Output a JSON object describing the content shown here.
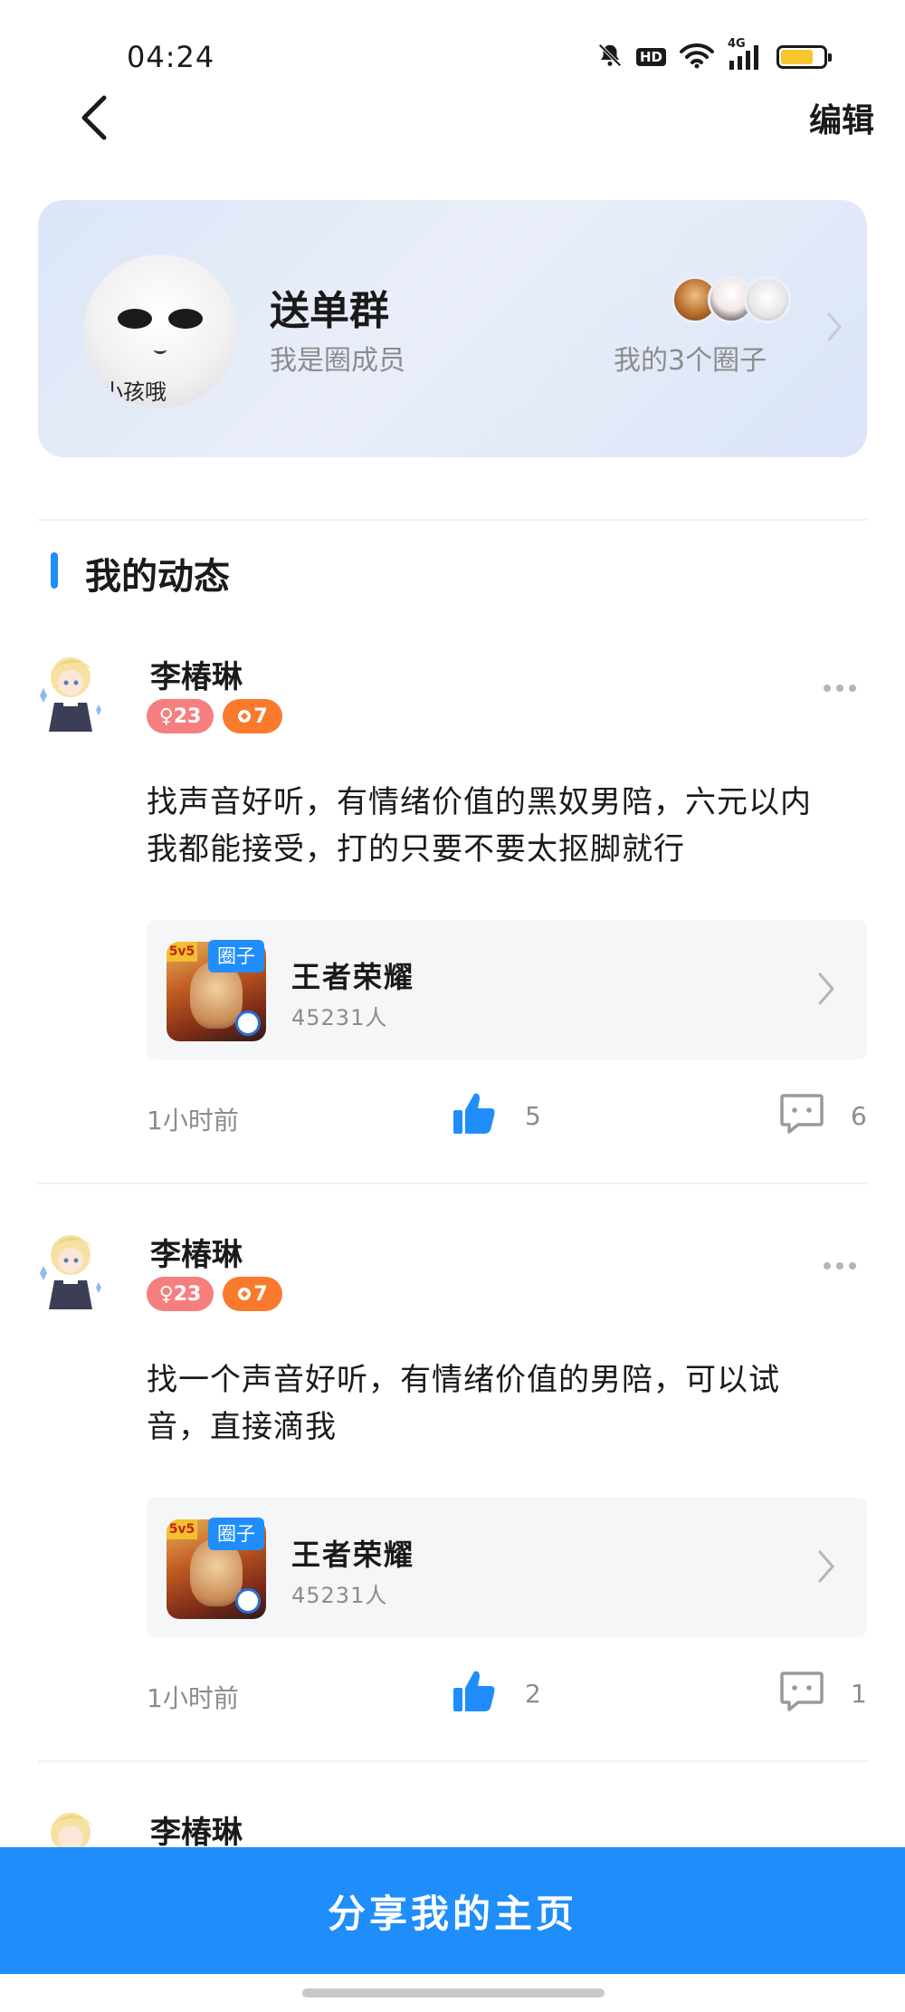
{
  "status_bar": {
    "time": "04:24",
    "hd_label": "HD",
    "network_label": "4G",
    "battery_level": 0.75,
    "battery_color": "#f7c62f",
    "icons": [
      "bell-off-icon",
      "hd-icon",
      "wifi-icon",
      "signal-icon",
      "battery-icon"
    ]
  },
  "nav": {
    "back_icon": "back-chevron-icon",
    "edit_label": "编辑"
  },
  "group": {
    "avatar_caption": "小孩哦",
    "name": "送单群",
    "role": "我是圈成员",
    "circle_count_label": "我的3个圈子",
    "accent": "#dce6f7"
  },
  "section": {
    "title": "我的动态",
    "accent": "#1f8efa"
  },
  "posts": [
    {
      "author": "李椿琳",
      "gender_badge": "♀23",
      "level_badge": "7",
      "text": "找声音好听，有情绪价值的黑奴男陪，六元以内我都能接受，打的只要不要太抠脚就行",
      "circle": {
        "tag": "圈子",
        "name": "王者荣耀",
        "members": "45231人"
      },
      "time": "1小时前",
      "likes": "5",
      "comments": "6"
    },
    {
      "author": "李椿琳",
      "gender_badge": "♀23",
      "level_badge": "7",
      "text": "找一个声音好听，有情绪价值的男陪，可以试音，直接滴我",
      "circle": {
        "tag": "圈子",
        "name": "王者荣耀",
        "members": "45231人"
      },
      "time": "1小时前",
      "likes": "2",
      "comments": "1"
    },
    {
      "author": "李椿琳"
    }
  ],
  "share_button": {
    "label": "分享我的主页",
    "color": "#1f8efa"
  }
}
